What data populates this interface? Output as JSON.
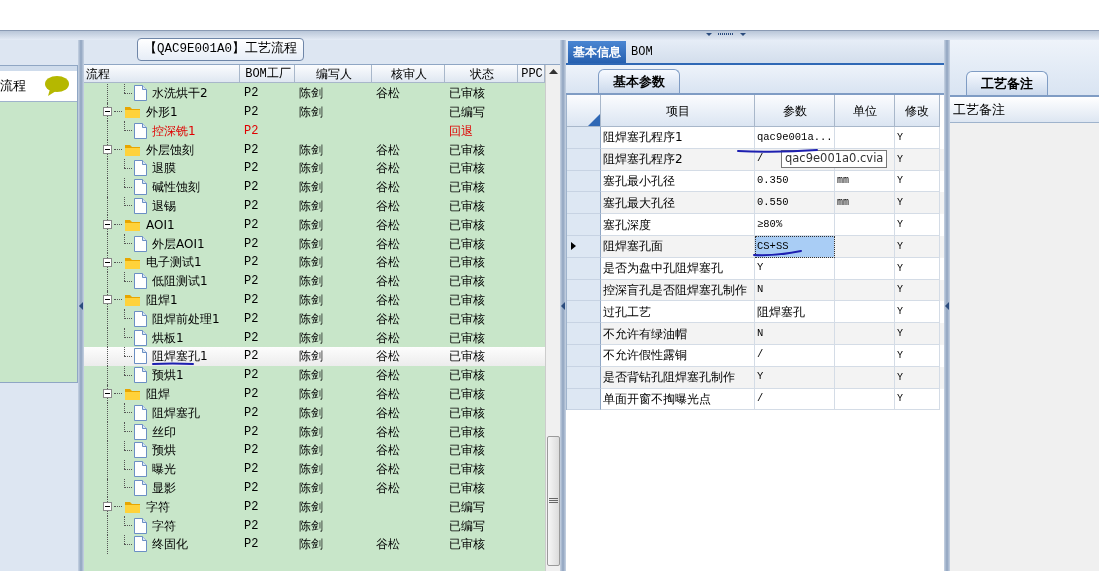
{
  "left_panel": {
    "title": "流程"
  },
  "process_panel": {
    "title": "【QAC9E001A0】工艺流程",
    "columns": [
      "流程",
      "BOM工厂",
      "编写人",
      "核审人",
      "状态",
      "PPC"
    ],
    "tree": [
      {
        "kind": "file",
        "name": "水洗烘干2",
        "bom": "P2",
        "writer": "陈剑",
        "reviewer": "谷松",
        "status": "已审核",
        "returned": false,
        "selected": false
      },
      {
        "kind": "folder",
        "name": "外形1",
        "bom": "P2",
        "writer": "陈剑",
        "status": "已编写",
        "returned": false,
        "selected": false,
        "expanded": true,
        "children": [
          {
            "kind": "file",
            "name": "控深铣1",
            "bom": "P2",
            "status": "回退",
            "returned": true,
            "selected": false
          }
        ]
      },
      {
        "kind": "folder",
        "name": "外层蚀刻",
        "bom": "P2",
        "writer": "陈剑",
        "reviewer": "谷松",
        "status": "已审核",
        "returned": false,
        "selected": false,
        "expanded": true,
        "children": [
          {
            "kind": "file",
            "name": "退膜",
            "bom": "P2",
            "writer": "陈剑",
            "reviewer": "谷松",
            "status": "已审核",
            "returned": false,
            "selected": false
          },
          {
            "kind": "file",
            "name": "碱性蚀刻",
            "bom": "P2",
            "writer": "陈剑",
            "reviewer": "谷松",
            "status": "已审核",
            "returned": false,
            "selected": false
          },
          {
            "kind": "file",
            "name": "退锡",
            "bom": "P2",
            "writer": "陈剑",
            "reviewer": "谷松",
            "status": "已审核",
            "returned": false,
            "selected": false
          }
        ]
      },
      {
        "kind": "folder",
        "name": "AOI1",
        "bom": "P2",
        "writer": "陈剑",
        "reviewer": "谷松",
        "status": "已审核",
        "returned": false,
        "selected": false,
        "expanded": true,
        "children": [
          {
            "kind": "file",
            "name": "外层AOI1",
            "bom": "P2",
            "writer": "陈剑",
            "reviewer": "谷松",
            "status": "已审核",
            "returned": false,
            "selected": false
          }
        ]
      },
      {
        "kind": "folder",
        "name": "电子测试1",
        "bom": "P2",
        "writer": "陈剑",
        "reviewer": "谷松",
        "status": "已审核",
        "returned": false,
        "selected": false,
        "expanded": true,
        "children": [
          {
            "kind": "file",
            "name": "低阻测试1",
            "bom": "P2",
            "writer": "陈剑",
            "reviewer": "谷松",
            "status": "已审核",
            "returned": false,
            "selected": false
          }
        ]
      },
      {
        "kind": "folder",
        "name": "阻焊1",
        "bom": "P2",
        "writer": "陈剑",
        "reviewer": "谷松",
        "status": "已审核",
        "returned": false,
        "selected": false,
        "expanded": true,
        "children": [
          {
            "kind": "file",
            "name": "阻焊前处理1",
            "bom": "P2",
            "writer": "陈剑",
            "reviewer": "谷松",
            "status": "已审核",
            "returned": false,
            "selected": false
          },
          {
            "kind": "file",
            "name": "烘板1",
            "bom": "P2",
            "writer": "陈剑",
            "reviewer": "谷松",
            "status": "已审核",
            "returned": false,
            "selected": false
          },
          {
            "kind": "file",
            "name": "阻焊塞孔1",
            "bom": "P2",
            "writer": "陈剑",
            "reviewer": "谷松",
            "status": "已审核",
            "returned": false,
            "selected": true
          },
          {
            "kind": "file",
            "name": "预烘1",
            "bom": "P2",
            "writer": "陈剑",
            "reviewer": "谷松",
            "status": "已审核",
            "returned": false,
            "selected": false
          }
        ]
      },
      {
        "kind": "folder",
        "name": "阻焊",
        "bom": "P2",
        "writer": "陈剑",
        "reviewer": "谷松",
        "status": "已审核",
        "returned": false,
        "selected": false,
        "expanded": true,
        "children": [
          {
            "kind": "file",
            "name": "阻焊塞孔",
            "bom": "P2",
            "writer": "陈剑",
            "reviewer": "谷松",
            "status": "已审核",
            "returned": false,
            "selected": false
          },
          {
            "kind": "file",
            "name": "丝印",
            "bom": "P2",
            "writer": "陈剑",
            "reviewer": "谷松",
            "status": "已审核",
            "returned": false,
            "selected": false
          },
          {
            "kind": "file",
            "name": "预烘",
            "bom": "P2",
            "writer": "陈剑",
            "reviewer": "谷松",
            "status": "已审核",
            "returned": false,
            "selected": false
          },
          {
            "kind": "file",
            "name": "曝光",
            "bom": "P2",
            "writer": "陈剑",
            "reviewer": "谷松",
            "status": "已审核",
            "returned": false,
            "selected": false
          },
          {
            "kind": "file",
            "name": "显影",
            "bom": "P2",
            "writer": "陈剑",
            "reviewer": "谷松",
            "status": "已审核",
            "returned": false,
            "selected": false
          }
        ]
      },
      {
        "kind": "folder",
        "name": "字符",
        "bom": "P2",
        "writer": "陈剑",
        "status": "已编写",
        "returned": false,
        "selected": false,
        "expanded": true,
        "children": [
          {
            "kind": "file",
            "name": "字符",
            "bom": "P2",
            "writer": "陈剑",
            "status": "已编写",
            "returned": false,
            "selected": false
          },
          {
            "kind": "file",
            "name": "终固化",
            "bom": "P2",
            "writer": "陈剑",
            "reviewer": "谷松",
            "status": "已审核",
            "returned": false,
            "selected": false
          }
        ]
      }
    ]
  },
  "detail_panel": {
    "tabs": [
      {
        "label": "基本信息",
        "selected": true
      },
      {
        "label": "BOM",
        "selected": false
      }
    ],
    "subtab": "基本参数",
    "columns": [
      "项目",
      "参数",
      "单位",
      "修改"
    ],
    "rows": [
      {
        "item": "阻焊塞孔程序1",
        "value": "qac9e001a...",
        "modify": "Y",
        "selected": false
      },
      {
        "item": "阻焊塞孔程序2",
        "value": "/",
        "modify": "Y",
        "selected": false
      },
      {
        "item": "塞孔最小孔径",
        "value": "0.350",
        "unit": "mm",
        "modify": "Y",
        "selected": false
      },
      {
        "item": "塞孔最大孔径",
        "value": "0.550",
        "unit": "mm",
        "modify": "Y",
        "selected": false
      },
      {
        "item": "塞孔深度",
        "value": "≥80%",
        "modify": "Y",
        "selected": false
      },
      {
        "item": "阻焊塞孔面",
        "value": "CS+SS",
        "modify": "Y",
        "selected": true
      },
      {
        "item": "是否为盘中孔阻焊塞孔",
        "value": "Y",
        "modify": "Y",
        "selected": false
      },
      {
        "item": "控深盲孔是否阻焊塞孔制作",
        "value": "N",
        "modify": "Y",
        "selected": false
      },
      {
        "item": "过孔工艺",
        "value": "阻焊塞孔",
        "modify": "Y",
        "selected": false
      },
      {
        "item": "不允许有绿油帽",
        "value": "N",
        "modify": "Y",
        "selected": false
      },
      {
        "item": "不允许假性露铜",
        "value": "/",
        "modify": "Y",
        "selected": false
      },
      {
        "item": "是否背钻孔阻焊塞孔制作",
        "value": "Y",
        "modify": "Y",
        "selected": false
      },
      {
        "item": "单面开窗不掏曝光点",
        "value": "/",
        "modify": "Y",
        "selected": false
      }
    ],
    "tooltip": "qac9e001a0.cvia"
  },
  "notes_panel": {
    "tab": "工艺备注",
    "header": "工艺备注"
  }
}
